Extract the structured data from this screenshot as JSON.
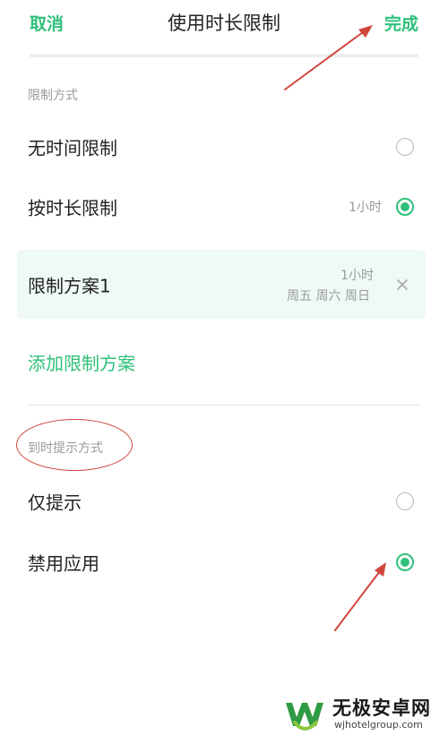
{
  "header": {
    "cancel_label": "取消",
    "title": "使用时长限制",
    "done_label": "完成"
  },
  "limit_section": {
    "label": "限制方式",
    "options": [
      {
        "label": "无时间限制",
        "value": "",
        "selected": false
      },
      {
        "label": "按时长限制",
        "value": "1小时",
        "selected": true
      }
    ]
  },
  "plans": [
    {
      "name": "限制方案1",
      "duration": "1小时",
      "days": "周五 周六 周日"
    }
  ],
  "add_plan_label": "添加限制方案",
  "alert_section": {
    "label": "到时提示方式",
    "options": [
      {
        "label": "仅提示",
        "selected": false
      },
      {
        "label": "禁用应用",
        "selected": true
      }
    ]
  },
  "watermark": {
    "brand": "无极安卓网",
    "url": "wjhotelgroup.com"
  },
  "colors": {
    "accent": "#2fc07a",
    "annotation": "#d0453b",
    "card_bg": "#eefaf3"
  }
}
